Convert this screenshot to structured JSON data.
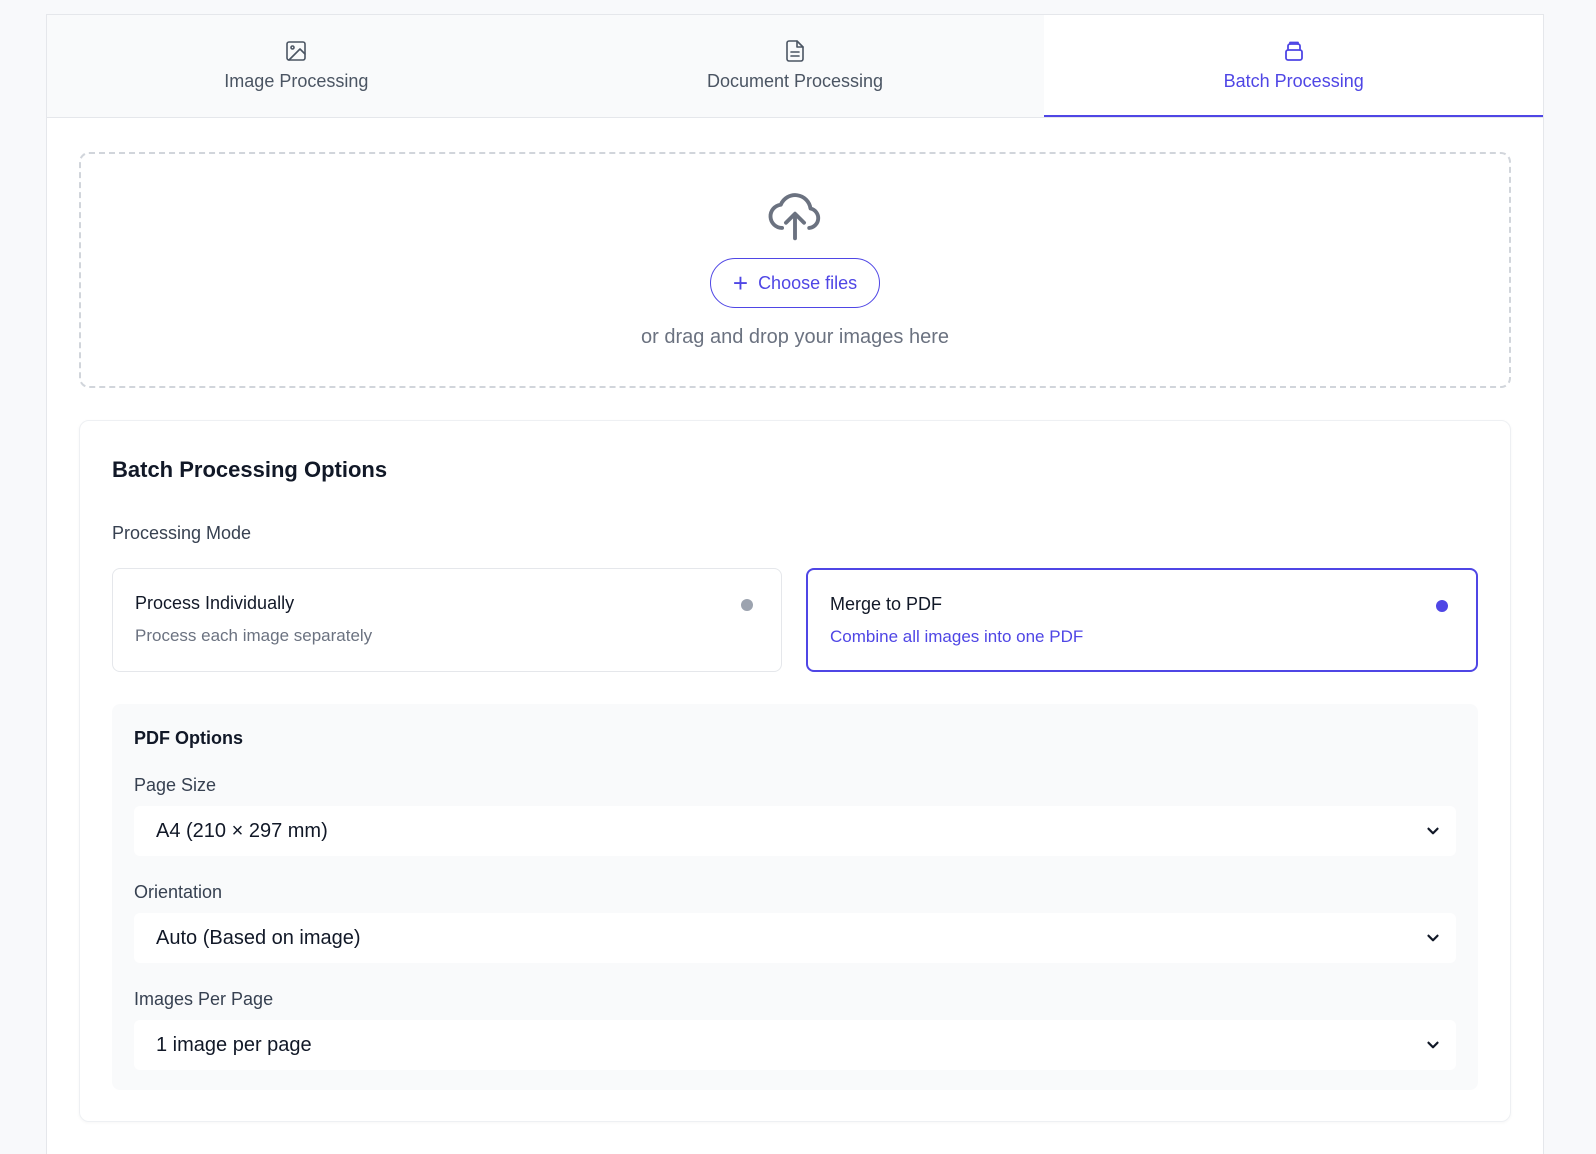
{
  "tabs": [
    {
      "label": "Image Processing",
      "icon": "image-icon"
    },
    {
      "label": "Document Processing",
      "icon": "document-icon"
    },
    {
      "label": "Batch Processing",
      "icon": "layers-icon",
      "active": true
    }
  ],
  "upload": {
    "button_label": "Choose files",
    "hint": "or drag and drop your images here"
  },
  "options": {
    "title": "Batch Processing Options",
    "mode_label": "Processing Mode",
    "modes": [
      {
        "title": "Process Individually",
        "desc": "Process each image separately",
        "selected": false
      },
      {
        "title": "Merge to PDF",
        "desc": "Combine all images into one PDF",
        "selected": true
      }
    ],
    "pdf": {
      "title": "PDF Options",
      "page_size_label": "Page Size",
      "page_size_value": "A4 (210 × 297 mm)",
      "orientation_label": "Orientation",
      "orientation_value": "Auto (Based on image)",
      "images_per_page_label": "Images Per Page",
      "images_per_page_value": "1 image per page"
    }
  },
  "colors": {
    "accent": "#4f46e5",
    "muted": "#6b7280",
    "border": "#e5e7eb"
  }
}
